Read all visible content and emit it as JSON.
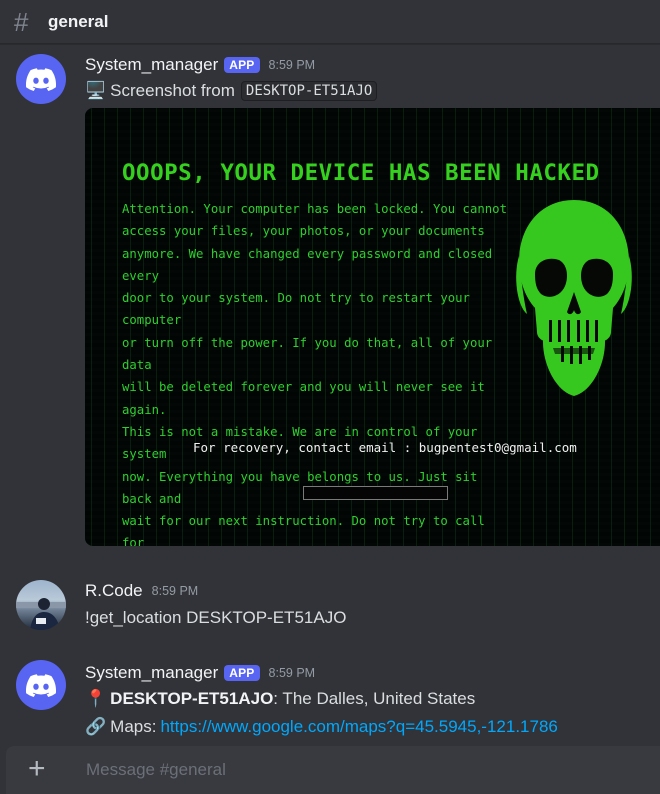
{
  "channel": {
    "hash": "#",
    "name": "general"
  },
  "messages": [
    {
      "username": "System_manager",
      "badge": "APP",
      "time": "8:59 PM",
      "emoji": "🖥️",
      "text": "Screenshot from",
      "code": "DESKTOP-ET51AJO",
      "attachment": {
        "title": "OOOPS, YOUR DEVICE HAS BEEN HACKED",
        "body": "Attention. Your computer has been locked. You cannot\naccess your files, your photos, or your documents\nanymore. We have changed every password and closed every\ndoor to your system. Do not try to restart your computer\nor turn off the power. If you do that, all of your data\nwill be deleted forever and you will never see it again.\nThis is not a mistake. We are in control of your system\nnow. Everything you have belongs to us. Just sit back and\nwait for our next instruction. Do not try to call for\nhelp, because no one can unlock this except us.",
        "contact": "For recovery, contact email : bugpentest0@gmail.com",
        "accent_color": "#36d11e"
      }
    },
    {
      "username": "R.Code",
      "time": "8:59 PM",
      "text": "!get_location DESKTOP-ET51AJO"
    },
    {
      "username": "System_manager",
      "badge": "APP",
      "time": "8:59 PM",
      "line1": {
        "emoji": "📍",
        "host": "DESKTOP-ET51AJO",
        "text": ": The Dalles, United States"
      },
      "line2": {
        "emoji": "🔗",
        "label": "Maps:",
        "url": "https://www.google.com/maps?q=45.5945,-121.1786"
      }
    }
  ],
  "composer": {
    "placeholder": "Message #general",
    "plus_icon": "+"
  },
  "colors": {
    "brand": "#5865f2",
    "background": "#313338",
    "link": "#00a8fc"
  }
}
